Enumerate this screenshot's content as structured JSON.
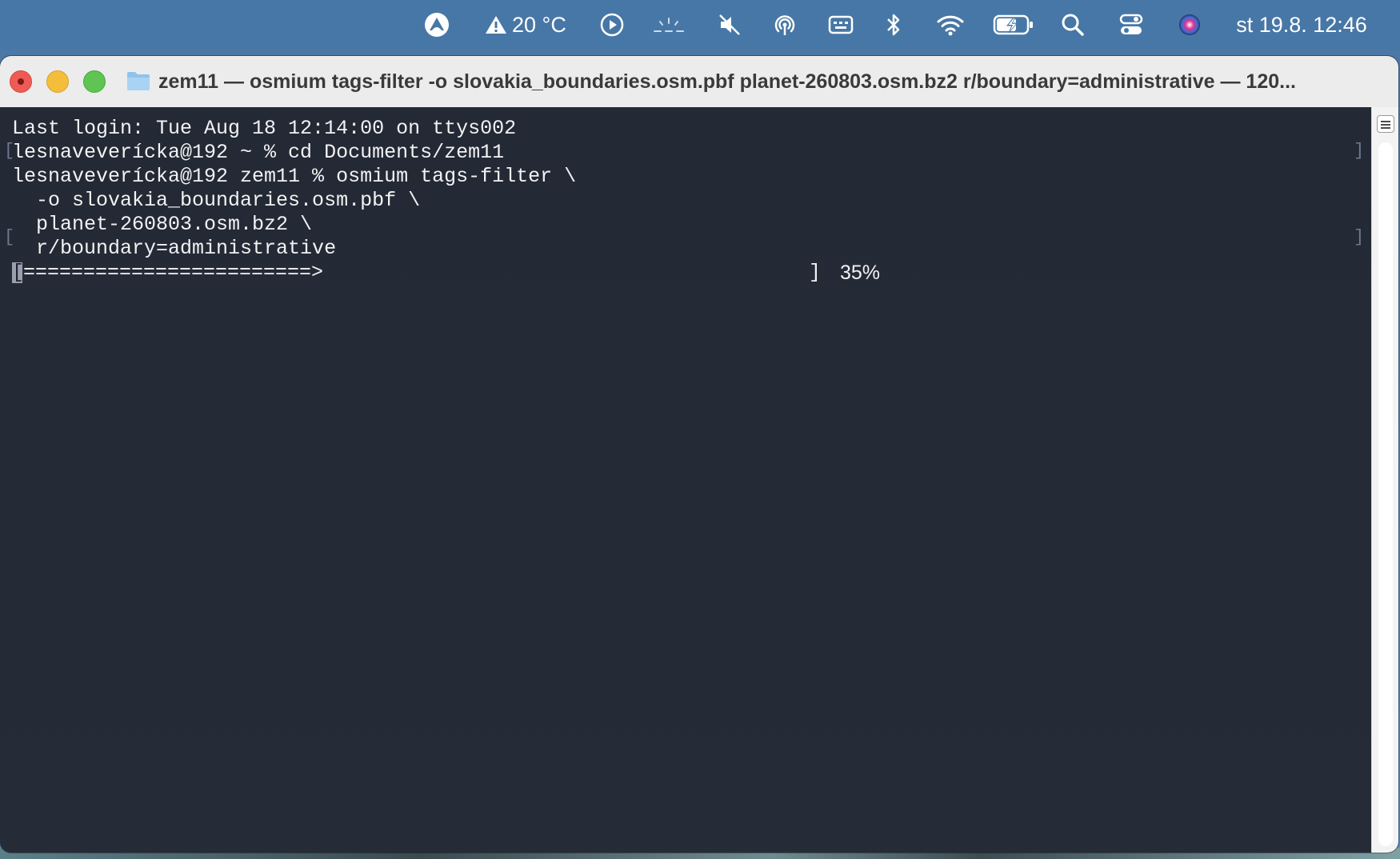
{
  "menubar": {
    "weather": "20 °C",
    "datetime": "st 19.8.  12:46"
  },
  "window": {
    "title": "zem11 — osmium tags-filter -o slovakia_boundaries.osm.pbf planet-260803.osm.bz2 r/boundary=administrative — 120..."
  },
  "terminal": {
    "lines": [
      "Last login: Tue Aug 18 12:14:00 on ttys002",
      "lesnaveverícka@192 ~ % cd Documents/zem11",
      "lesnaveverícka@192 zem11 % osmium tags-filter \\",
      "  -o slovakia_boundaries.osm.pbf \\",
      "  planet-260803.osm.bz2 \\",
      "  r/boundary=administrative"
    ],
    "progress": {
      "open": "[",
      "bar": "========================>",
      "close": "]",
      "percent": "35%",
      "value": 35
    }
  },
  "colors": {
    "terminal_bg": "#252b37",
    "terminal_fg": "#f2f2f2",
    "menubar_bg": "#4777a6",
    "close": "#ee5b55",
    "minimize": "#f4bd3b",
    "maximize": "#5fc454"
  },
  "icons": [
    "app-logo-icon",
    "warning-icon",
    "play-icon",
    "brightness-icon",
    "mute-icon",
    "airdrop-icon",
    "keyboard-icon",
    "bluetooth-icon",
    "wifi-icon",
    "battery-icon",
    "search-icon",
    "control-center-icon",
    "siri-icon",
    "folder-icon"
  ]
}
